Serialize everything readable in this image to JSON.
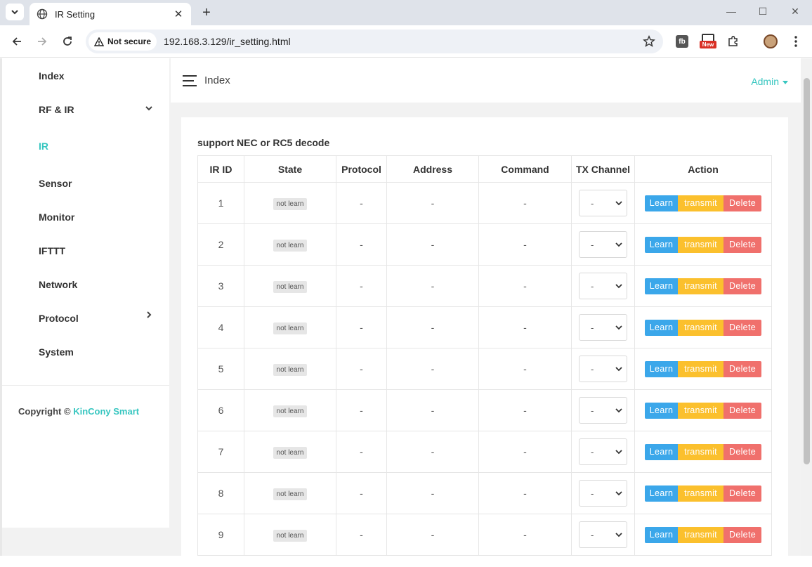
{
  "browser": {
    "tab_title": "IR Setting",
    "security_label": "Not secure",
    "url": "192.168.3.129/ir_setting.html",
    "new_badge": "New"
  },
  "sidebar": {
    "items": [
      {
        "label": "Index",
        "active": false
      },
      {
        "label": "RF & IR",
        "active": false,
        "arrow": "chevron-down-icon"
      },
      {
        "label": "IR",
        "active": true
      },
      {
        "label": "Sensor",
        "active": false
      },
      {
        "label": "Monitor",
        "active": false
      },
      {
        "label": "IFTTT",
        "active": false
      },
      {
        "label": "Network",
        "active": false
      },
      {
        "label": "Protocol",
        "active": false,
        "arrow": "chevron-right-icon"
      },
      {
        "label": "System",
        "active": false
      }
    ],
    "copyright_prefix": "Copyright ©",
    "copyright_brand": "KinCony Smart"
  },
  "header": {
    "crumb": "Index",
    "user": "Admin"
  },
  "main": {
    "title": "support NEC or RC5 decode",
    "columns": [
      "IR ID",
      "State",
      "Protocol",
      "Address",
      "Command",
      "TX Channel",
      "Action"
    ],
    "rows": [
      {
        "id": "1",
        "state": "not learn",
        "protocol": "-",
        "address": "-",
        "command": "-",
        "channel": "-"
      },
      {
        "id": "2",
        "state": "not learn",
        "protocol": "-",
        "address": "-",
        "command": "-",
        "channel": "-"
      },
      {
        "id": "3",
        "state": "not learn",
        "protocol": "-",
        "address": "-",
        "command": "-",
        "channel": "-"
      },
      {
        "id": "4",
        "state": "not learn",
        "protocol": "-",
        "address": "-",
        "command": "-",
        "channel": "-"
      },
      {
        "id": "5",
        "state": "not learn",
        "protocol": "-",
        "address": "-",
        "command": "-",
        "channel": "-"
      },
      {
        "id": "6",
        "state": "not learn",
        "protocol": "-",
        "address": "-",
        "command": "-",
        "channel": "-"
      },
      {
        "id": "7",
        "state": "not learn",
        "protocol": "-",
        "address": "-",
        "command": "-",
        "channel": "-"
      },
      {
        "id": "8",
        "state": "not learn",
        "protocol": "-",
        "address": "-",
        "command": "-",
        "channel": "-"
      },
      {
        "id": "9",
        "state": "not learn",
        "protocol": "-",
        "address": "-",
        "command": "-",
        "channel": "-"
      }
    ],
    "action_labels": {
      "learn": "Learn",
      "transmit": "transmit",
      "delete": "Delete"
    }
  },
  "colors": {
    "accent": "#37c6c0",
    "learn": "#3ba7ea",
    "transmit": "#fbc02d",
    "delete": "#f0706c"
  }
}
